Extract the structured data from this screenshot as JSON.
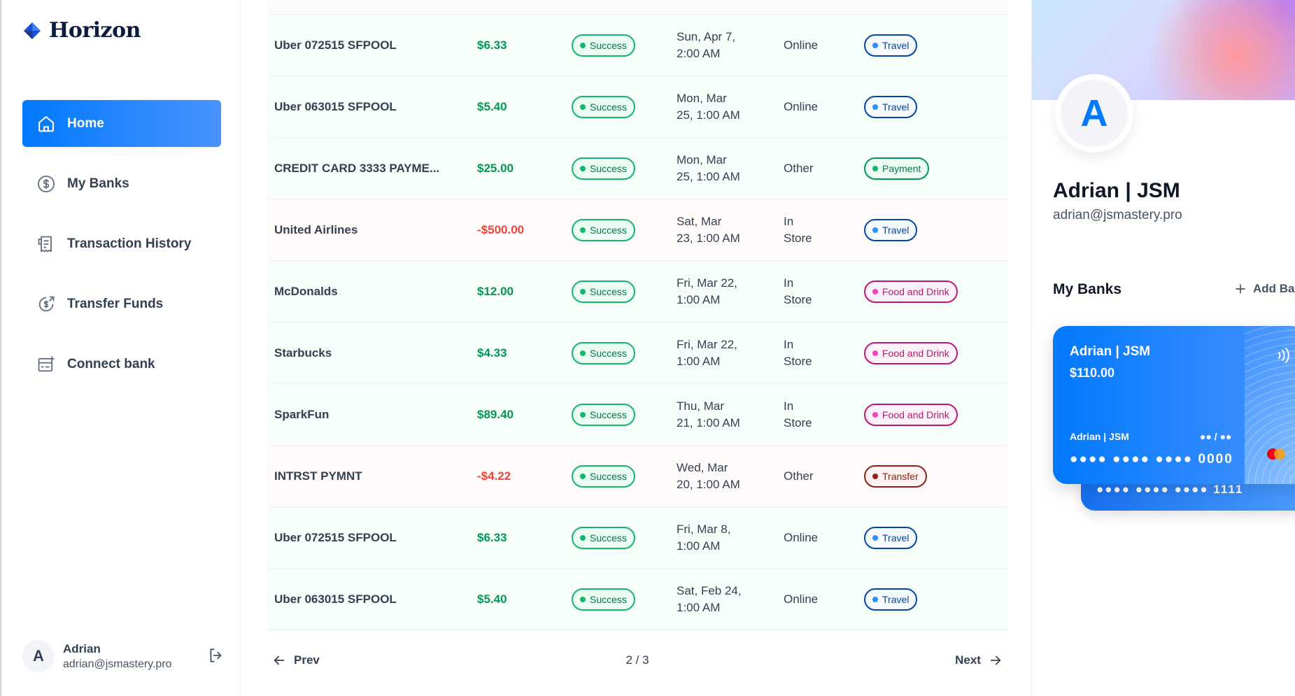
{
  "brand": {
    "name": "Horizon"
  },
  "nav": {
    "items": [
      {
        "label": "Home",
        "icon": "home-icon",
        "active": true
      },
      {
        "label": "My Banks",
        "icon": "dollar-circle-icon",
        "active": false
      },
      {
        "label": "Transaction History",
        "icon": "receipt-icon",
        "active": false
      },
      {
        "label": "Transfer Funds",
        "icon": "money-send-icon",
        "active": false
      },
      {
        "label": "Connect bank",
        "icon": "connect-bank-icon",
        "active": false
      }
    ]
  },
  "footer": {
    "initial": "A",
    "name": "Adrian",
    "email": "adrian@jsmastery.pro"
  },
  "transactions": [
    {
      "name": "Uber 072515 SFPOOL",
      "amount": "$6.33",
      "type": "pos",
      "status": "Success",
      "date1": "Sun, Apr 7,",
      "date2": "2:00 AM",
      "channel1": "Online",
      "channel2": "",
      "category": "Travel",
      "cat_class": "travel"
    },
    {
      "name": "Uber 063015 SFPOOL",
      "amount": "$5.40",
      "type": "pos",
      "status": "Success",
      "date1": "Mon, Mar",
      "date2": "25, 1:00 AM",
      "channel1": "Online",
      "channel2": "",
      "category": "Travel",
      "cat_class": "travel"
    },
    {
      "name": "CREDIT CARD 3333 PAYME...",
      "amount": "$25.00",
      "type": "pos",
      "status": "Success",
      "date1": "Mon, Mar",
      "date2": "25, 1:00 AM",
      "channel1": "Other",
      "channel2": "",
      "category": "Payment",
      "cat_class": "payment"
    },
    {
      "name": "United Airlines",
      "amount": "-$500.00",
      "type": "neg",
      "status": "Success",
      "date1": "Sat, Mar",
      "date2": "23, 1:00 AM",
      "channel1": "In",
      "channel2": "Store",
      "category": "Travel",
      "cat_class": "travel"
    },
    {
      "name": "McDonalds",
      "amount": "$12.00",
      "type": "pos",
      "status": "Success",
      "date1": "Fri, Mar 22,",
      "date2": "1:00 AM",
      "channel1": "In",
      "channel2": "Store",
      "category": "Food and Drink",
      "cat_class": "food"
    },
    {
      "name": "Starbucks",
      "amount": "$4.33",
      "type": "pos",
      "status": "Success",
      "date1": "Fri, Mar 22,",
      "date2": "1:00 AM",
      "channel1": "In",
      "channel2": "Store",
      "category": "Food and Drink",
      "cat_class": "food"
    },
    {
      "name": "SparkFun",
      "amount": "$89.40",
      "type": "pos",
      "status": "Success",
      "date1": "Thu, Mar",
      "date2": "21, 1:00 AM",
      "channel1": "In",
      "channel2": "Store",
      "category": "Food and Drink",
      "cat_class": "food"
    },
    {
      "name": "INTRST PYMNT",
      "amount": "-$4.22",
      "type": "neg",
      "status": "Success",
      "date1": "Wed, Mar",
      "date2": "20, 1:00 AM",
      "channel1": "Other",
      "channel2": "",
      "category": "Transfer",
      "cat_class": "transfer"
    },
    {
      "name": "Uber 072515 SFPOOL",
      "amount": "$6.33",
      "type": "pos",
      "status": "Success",
      "date1": "Fri, Mar 8,",
      "date2": "1:00 AM",
      "channel1": "Online",
      "channel2": "",
      "category": "Travel",
      "cat_class": "travel"
    },
    {
      "name": "Uber 063015 SFPOOL",
      "amount": "$5.40",
      "type": "pos",
      "status": "Success",
      "date1": "Sat, Feb 24,",
      "date2": "1:00 AM",
      "channel1": "Online",
      "channel2": "",
      "category": "Travel",
      "cat_class": "travel"
    }
  ],
  "pagination": {
    "prev": "Prev",
    "next": "Next",
    "page_text": "2 / 3"
  },
  "profile": {
    "initial": "A",
    "name": "Adrian | JSM",
    "email": "adrian@jsmastery.pro"
  },
  "banks": {
    "title": "My Banks",
    "add_label": "Add Bank",
    "card": {
      "name": "Adrian | JSM",
      "balance": "$110.00",
      "user": "Adrian | JSM",
      "expiry": "●● / ●●",
      "number": "●●●● ●●●● ●●●● 0000"
    },
    "back_card": {
      "number": "●●●● ●●●● ●●●● 1111"
    }
  },
  "colors": {
    "accent": "#0179fe",
    "positive": "#039855",
    "negative": "#f04438"
  }
}
